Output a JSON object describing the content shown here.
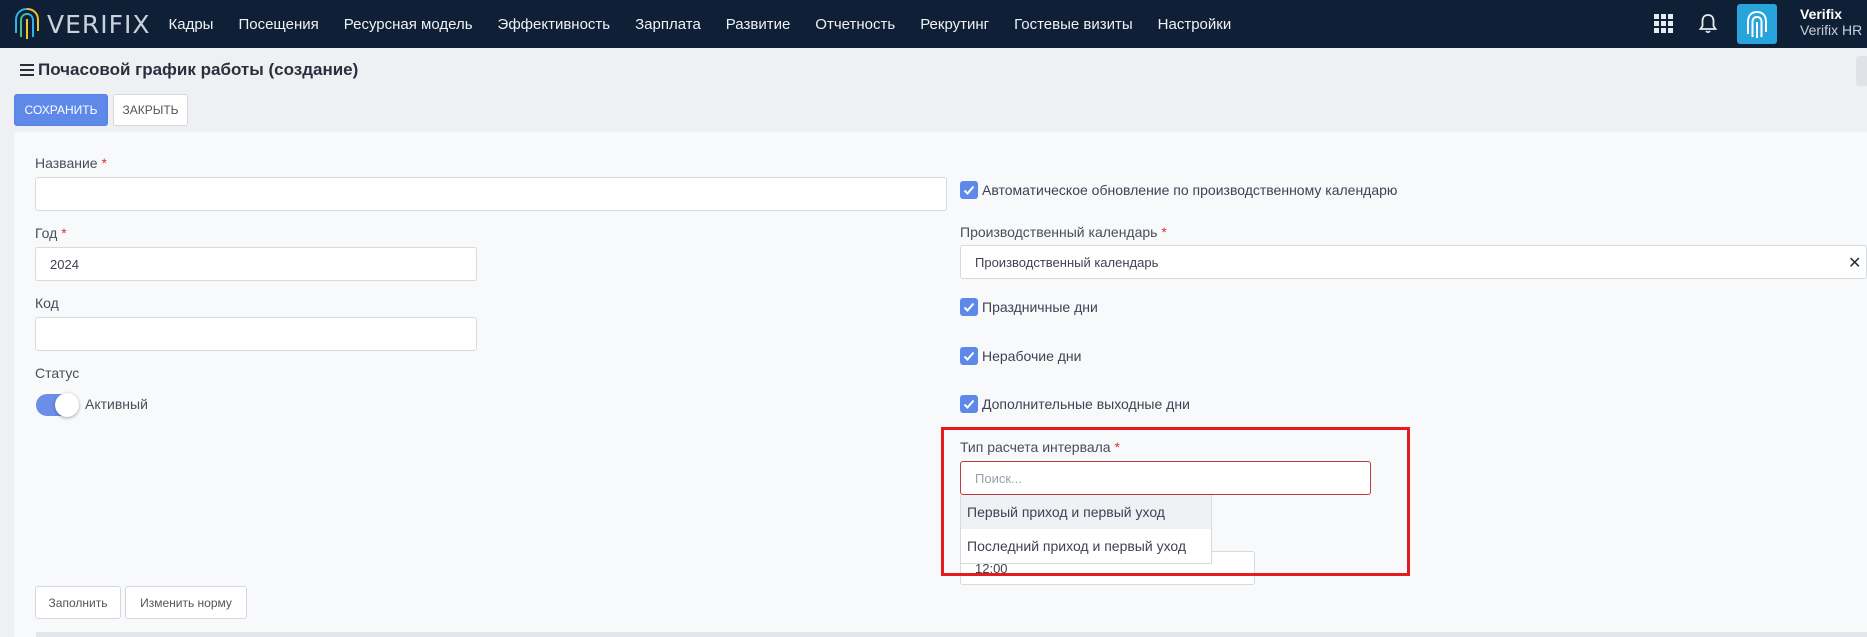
{
  "brand": {
    "logo_text": "VERIFIX",
    "accent": "#5e89e8",
    "nav_bg": "#0f1f35"
  },
  "nav": {
    "items": [
      "Кадры",
      "Посещения",
      "Ресурсная модель",
      "Эффективность",
      "Зарплата",
      "Развитие",
      "Отчетность",
      "Рекрутинг",
      "Гостевые визиты",
      "Настройки"
    ]
  },
  "user": {
    "name": "Verifix",
    "org": "Verifix HR"
  },
  "icons": {
    "apps": "apps-grid-icon",
    "bell": "bell-icon",
    "menu": "menu-icon",
    "logo": "fingerprint-icon",
    "check": "check-icon",
    "clear": "close-icon"
  },
  "page": {
    "title": "Почасовой график работы (создание)"
  },
  "toolbar": {
    "save_label": "СОХРАНИТЬ",
    "close_label": "ЗАКРЫТЬ"
  },
  "form": {
    "name": {
      "label": "Название",
      "required": "*",
      "value": ""
    },
    "year": {
      "label": "Год",
      "required": "*",
      "value": "2024"
    },
    "code": {
      "label": "Код",
      "value": ""
    },
    "status": {
      "label": "Статус",
      "value": "Активный",
      "on": true
    },
    "auto_update": {
      "label": "Автоматическое обновление по производственному календарю",
      "checked": true
    },
    "calendar": {
      "label": "Производственный календарь",
      "required": "*",
      "value": "Производственный календарь",
      "clear": "✕"
    },
    "holidays": {
      "label": "Праздничные дни",
      "checked": true
    },
    "nonworking": {
      "label": "Нерабочие дни",
      "checked": true
    },
    "extra_days_off": {
      "label": "Дополнительные выходные дни",
      "checked": true
    },
    "interval_type": {
      "label": "Тип расчета интервала",
      "required": "*",
      "placeholder": "Поиск...",
      "options": [
        "Первый приход и первый уход",
        "Последний приход и первый уход"
      ]
    },
    "time_value": "12:00"
  },
  "actions": {
    "fill_label": "Заполнить",
    "change_norm_label": "Изменить норму"
  }
}
